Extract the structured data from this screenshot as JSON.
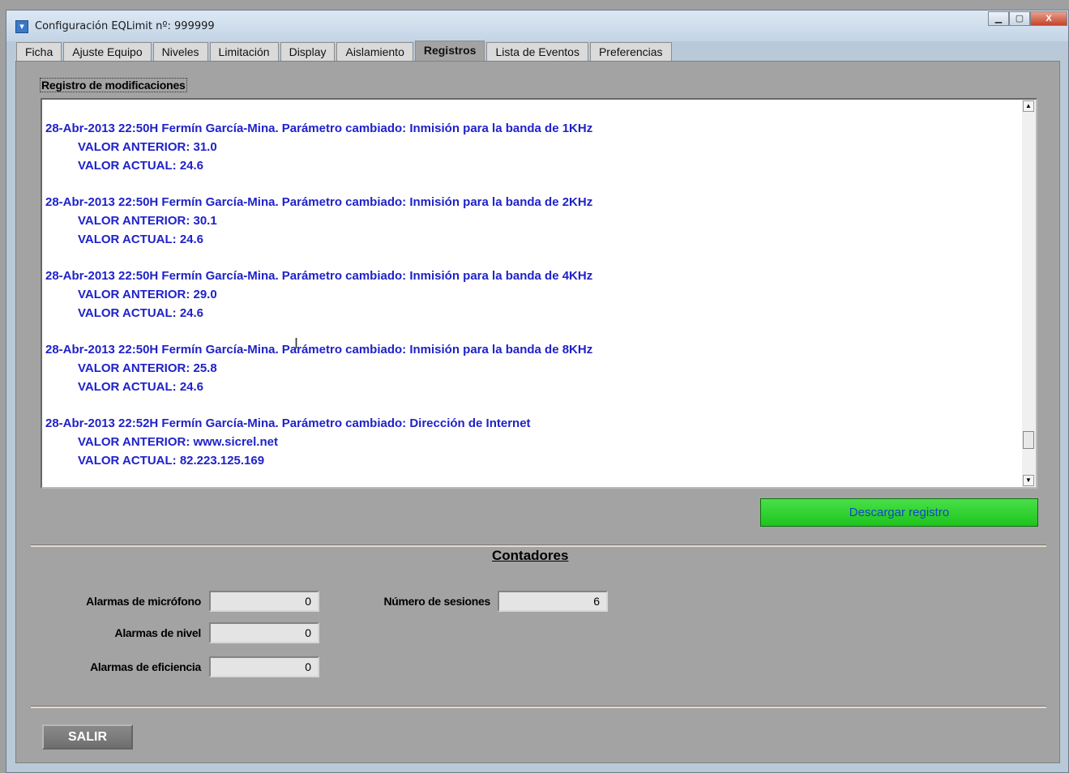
{
  "window": {
    "title": "Configuración EQLimit nº: 999999",
    "buttons": {
      "minimize": "▁",
      "maximize": "▢",
      "close": "X"
    }
  },
  "tabs": [
    {
      "label": "Ficha"
    },
    {
      "label": "Ajuste Equipo"
    },
    {
      "label": "Niveles"
    },
    {
      "label": "Limitación"
    },
    {
      "label": "Display"
    },
    {
      "label": "Aislamiento"
    },
    {
      "label": "Registros"
    },
    {
      "label": "Lista de Eventos"
    },
    {
      "label": "Preferencias"
    }
  ],
  "active_tab": "Registros",
  "log": {
    "section_label": "Registro de modificaciones",
    "entries": [
      {
        "header": "28-Abr-2013  22:50H  Fermín García-Mina.  Parámetro cambiado: Inmisión para la banda de 1KHz",
        "prev": "VALOR ANTERIOR:  31.0",
        "curr": "VALOR ACTUAL:  24.6"
      },
      {
        "header": "28-Abr-2013  22:50H  Fermín García-Mina.  Parámetro cambiado: Inmisión para la banda de 2KHz",
        "prev": "VALOR ANTERIOR:  30.1",
        "curr": "VALOR ACTUAL:  24.6"
      },
      {
        "header": "28-Abr-2013  22:50H  Fermín García-Mina.  Parámetro cambiado: Inmisión para la banda de 4KHz",
        "prev": "VALOR ANTERIOR:  29.0",
        "curr": "VALOR ACTUAL:  24.6"
      },
      {
        "header": "28-Abr-2013  22:50H  Fermín García-Mina.  Parámetro cambiado: Inmisión para la banda de 8KHz",
        "prev": "VALOR ANTERIOR:  25.8",
        "curr": "VALOR ACTUAL:  24.6"
      },
      {
        "header": "28-Abr-2013  22:52H  Fermín García-Mina.  Parámetro cambiado: Dirección de Internet",
        "prev": "VALOR ANTERIOR:  www.sicrel.net",
        "curr": "VALOR ACTUAL:  82.223.125.169"
      }
    ],
    "download_button": "Descargar registro"
  },
  "counters": {
    "title": "Contadores",
    "mic_alarms_label": "Alarmas de micrófono",
    "mic_alarms_value": "0",
    "level_alarms_label": "Alarmas de nivel",
    "level_alarms_value": "0",
    "efficiency_alarms_label": "Alarmas de eficiencia",
    "efficiency_alarms_value": "0",
    "sessions_label": "Número de sesiones",
    "sessions_value": "6"
  },
  "exit_button": "SALIR",
  "colors": {
    "log_text": "#1f22c9",
    "download_button": "#2bd12b",
    "panel_bg": "#a3a3a3"
  }
}
